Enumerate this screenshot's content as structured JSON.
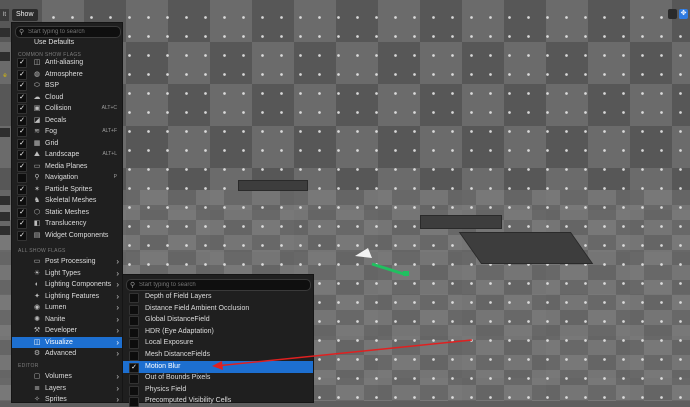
{
  "toolbar": {
    "show_label": "Show",
    "left_icon": "lt"
  },
  "left_strip": {
    "marks": [
      "e"
    ]
  },
  "menu": {
    "search_placeholder": "Start typing to search",
    "use_defaults": "Use Defaults",
    "section_common": "COMMON SHOW FLAGS",
    "section_all": "ALL SHOW FLAGS",
    "section_editor": "EDITOR",
    "common_items": [
      {
        "label": "Anti-aliasing",
        "icon": "antialias-icon",
        "glyph": "◫",
        "checked": true,
        "shortcut": ""
      },
      {
        "label": "Atmosphere",
        "icon": "atmosphere-icon",
        "glyph": "◍",
        "checked": true,
        "shortcut": ""
      },
      {
        "label": "BSP",
        "icon": "bsp-icon",
        "glyph": "⬭",
        "checked": true,
        "shortcut": ""
      },
      {
        "label": "Cloud",
        "icon": "cloud-icon",
        "glyph": "☁",
        "checked": true,
        "shortcut": ""
      },
      {
        "label": "Collision",
        "icon": "collision-icon",
        "glyph": "▣",
        "checked": true,
        "shortcut": "ALT+C"
      },
      {
        "label": "Decals",
        "icon": "decals-icon",
        "glyph": "◪",
        "checked": true,
        "shortcut": ""
      },
      {
        "label": "Fog",
        "icon": "fog-icon",
        "glyph": "≋",
        "checked": true,
        "shortcut": "ALT+F"
      },
      {
        "label": "Grid",
        "icon": "grid-icon",
        "glyph": "▦",
        "checked": true,
        "shortcut": ""
      },
      {
        "label": "Landscape",
        "icon": "landscape-icon",
        "glyph": "⛰",
        "checked": true,
        "shortcut": "ALT+L"
      },
      {
        "label": "Media Planes",
        "icon": "media-planes-icon",
        "glyph": "▭",
        "checked": true,
        "shortcut": ""
      },
      {
        "label": "Navigation",
        "icon": "navigation-icon",
        "glyph": "⚲",
        "checked": false,
        "shortcut": "P"
      },
      {
        "label": "Particle Sprites",
        "icon": "particle-sprites-icon",
        "glyph": "✶",
        "checked": true,
        "shortcut": ""
      },
      {
        "label": "Skeletal Meshes",
        "icon": "skeletal-meshes-icon",
        "glyph": "♞",
        "checked": true,
        "shortcut": ""
      },
      {
        "label": "Static Meshes",
        "icon": "static-meshes-icon",
        "glyph": "⬡",
        "checked": true,
        "shortcut": ""
      },
      {
        "label": "Translucency",
        "icon": "translucency-icon",
        "glyph": "◧",
        "checked": true,
        "shortcut": ""
      },
      {
        "label": "Widget Components",
        "icon": "widget-components-icon",
        "glyph": "▤",
        "checked": true,
        "shortcut": ""
      }
    ],
    "all_items": [
      {
        "label": "Post Processing",
        "icon": "post-processing-icon",
        "glyph": "▭",
        "selected": false
      },
      {
        "label": "Light Types",
        "icon": "light-types-icon",
        "glyph": "☀",
        "selected": false
      },
      {
        "label": "Lighting Components",
        "icon": "lighting-components-icon",
        "glyph": "◐",
        "selected": false
      },
      {
        "label": "Lighting Features",
        "icon": "lighting-features-icon",
        "glyph": "✦",
        "selected": false
      },
      {
        "label": "Lumen",
        "icon": "lumen-icon",
        "glyph": "◉",
        "selected": false
      },
      {
        "label": "Nanite",
        "icon": "nanite-icon",
        "glyph": "✺",
        "selected": false
      },
      {
        "label": "Developer",
        "icon": "developer-icon",
        "glyph": "⚒",
        "selected": false
      },
      {
        "label": "Visualize",
        "icon": "visualize-icon",
        "glyph": "◫",
        "selected": true
      },
      {
        "label": "Advanced",
        "icon": "advanced-icon",
        "glyph": "⚙",
        "selected": false
      }
    ],
    "editor_items": [
      {
        "label": "Volumes",
        "icon": "volumes-icon",
        "glyph": "▢"
      },
      {
        "label": "Layers",
        "icon": "layers-icon",
        "glyph": "≣"
      },
      {
        "label": "Sprites",
        "icon": "sprites-icon",
        "glyph": "✧"
      }
    ]
  },
  "submenu": {
    "search_placeholder": "Start typing to search",
    "items": [
      {
        "label": "Depth of Field Layers",
        "checked": false,
        "selected": false
      },
      {
        "label": "Distance Field Ambient Occlusion",
        "checked": false,
        "selected": false
      },
      {
        "label": "Global DistanceField",
        "checked": false,
        "selected": false
      },
      {
        "label": "HDR (Eye Adaptation)",
        "checked": false,
        "selected": false
      },
      {
        "label": "Local Exposure",
        "checked": false,
        "selected": false
      },
      {
        "label": "Mesh DistanceFields",
        "checked": false,
        "selected": false
      },
      {
        "label": "Motion Blur",
        "checked": true,
        "selected": true
      },
      {
        "label": "Out of Bounds Pixels",
        "checked": false,
        "selected": false
      },
      {
        "label": "Physics Field",
        "checked": false,
        "selected": false
      },
      {
        "label": "Precomputed Visibility Cells",
        "checked": false,
        "selected": false
      }
    ]
  },
  "colors": {
    "accent": "#1d6fd0",
    "annotation": "#e02020",
    "gizmo": "#20c060"
  }
}
